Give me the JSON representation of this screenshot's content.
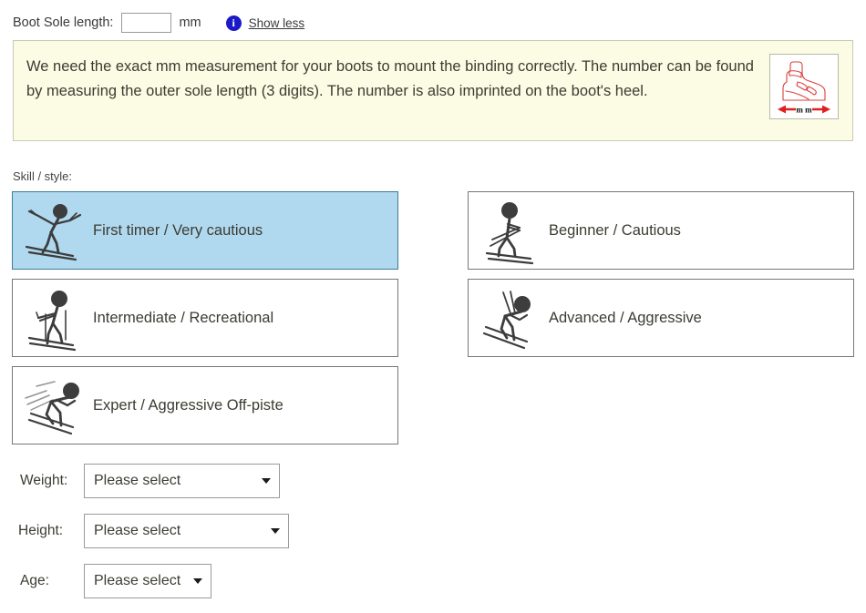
{
  "boot_sole": {
    "label": "Boot Sole length:",
    "input_value": "",
    "input_placeholder": "",
    "unit": "mm",
    "info_icon_glyph": "i",
    "toggle_link": "Show less"
  },
  "note": {
    "text": "We need the exact mm measurement for your boots to mount the binding correctly. The number can be found by measuring the outer sole length (3 digits). The number is also imprinted on the boot's heel.",
    "figure_caption": "m m",
    "figure_icon": "ski-boot-measurement-illustration",
    "background_color": "#fcfbe4",
    "border_color": "#c9c9b6",
    "figure_line_color": "#d42a2a"
  },
  "skill": {
    "label": "Skill / style:",
    "selected_index": 0,
    "selected_background": "#b0d8ef",
    "selected_border": "#3f7d96",
    "options": [
      {
        "label": "First timer / Very cautious",
        "icon": "skier-first-timer-icon"
      },
      {
        "label": "Beginner / Cautious",
        "icon": "skier-beginner-icon"
      },
      {
        "label": "Intermediate / Recreational",
        "icon": "skier-intermediate-icon"
      },
      {
        "label": "Advanced / Aggressive",
        "icon": "skier-advanced-icon"
      },
      {
        "label": "Expert / Aggressive Off-piste",
        "icon": "skier-expert-icon"
      }
    ]
  },
  "fields": {
    "weight": {
      "label": "Weight:",
      "value": "Please select"
    },
    "height": {
      "label": "Height:",
      "value": "Please select"
    },
    "age": {
      "label": "Age:",
      "value": "Please select"
    }
  }
}
